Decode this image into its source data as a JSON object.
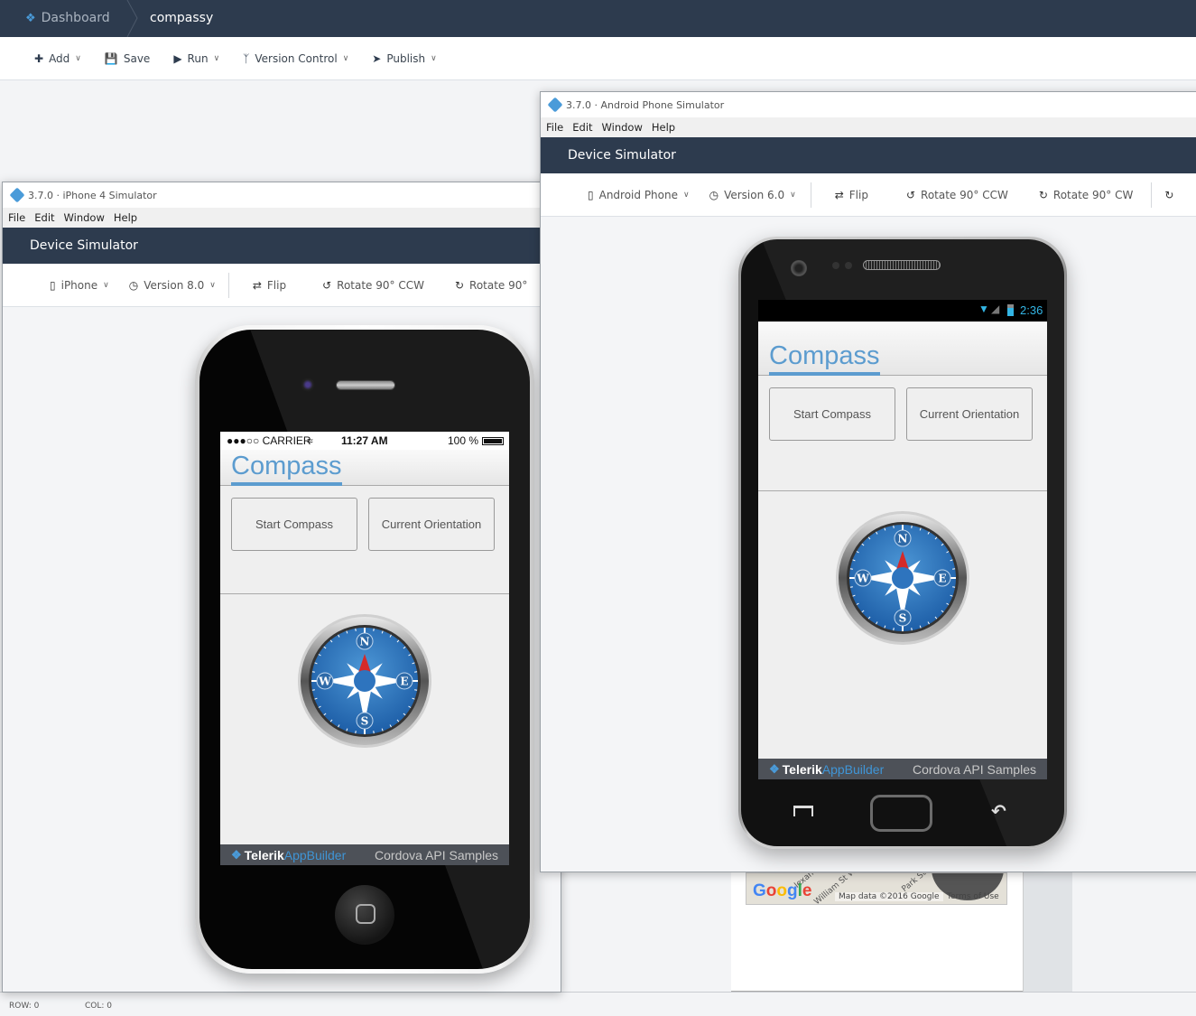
{
  "topnav": {
    "dashboard_label": "Dashboard",
    "project_name": "compassy"
  },
  "toolbar": {
    "items": [
      {
        "label": "Add",
        "icon": "plus-icon",
        "dropdown": true
      },
      {
        "label": "Save",
        "icon": "floppy-icon",
        "dropdown": false
      },
      {
        "label": "Run",
        "icon": "play-circle-icon",
        "dropdown": true
      },
      {
        "label": "Version Control",
        "icon": "branch-icon",
        "dropdown": true
      },
      {
        "label": "Publish",
        "icon": "paper-plane-icon",
        "dropdown": true
      }
    ]
  },
  "iphone_window": {
    "title": "3.7.0 · iPhone 4 Simulator",
    "menu": [
      "File",
      "Edit",
      "Window",
      "Help"
    ],
    "header": "Device Simulator",
    "toolbar": {
      "device": "iPhone",
      "version": "Version 8.0",
      "flip": "Flip",
      "rotate_ccw": "Rotate 90° CCW",
      "rotate_cw": "Rotate 90°"
    },
    "status": {
      "carrier": "●●●○○ CARRIER",
      "time": "11:27 AM",
      "battery": "100 %"
    }
  },
  "android_window": {
    "title": "3.7.0 · Android Phone Simulator",
    "menu": [
      "File",
      "Edit",
      "Window",
      "Help"
    ],
    "header": "Device Simulator",
    "toolbar": {
      "device": "Android Phone",
      "version": "Version 6.0",
      "flip": "Flip",
      "rotate_ccw": "Rotate 90° CCW",
      "rotate_cw": "Rotate 90° CW"
    },
    "status": {
      "time": "2:36"
    }
  },
  "app": {
    "title": "Compass",
    "buttons": [
      "Start Compass",
      "Current Orientation"
    ],
    "compass_letters": {
      "n": "N",
      "e": "E",
      "s": "S",
      "w": "W"
    },
    "footer": {
      "brand": "Telerik",
      "product": "AppBuilder",
      "caption": "Cordova API Samples"
    }
  },
  "map": {
    "logo": [
      "G",
      "o",
      "o",
      "g",
      "l",
      "e"
    ],
    "attribution": "Map data ©2016 Google",
    "terms": "Terms of Use",
    "streets": [
      "William St W",
      "Park St",
      "lexan",
      "W"
    ]
  },
  "statusbar": {
    "row": "ROW: 0",
    "col": "COL: 0"
  },
  "colors": {
    "nav_bg": "#2d3b4e",
    "accent": "#4a9bd9",
    "app_title": "#5c9ccf",
    "android_status": "#33b5e5"
  }
}
